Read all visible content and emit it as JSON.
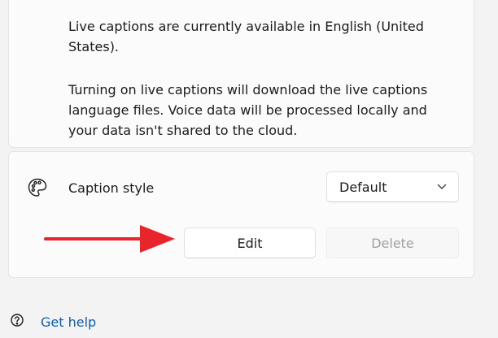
{
  "live_captions": {
    "availability_text": "Live captions are currently available in English (United States).",
    "download_notice": "Turning on live captions will download the live captions language files. Voice data will be processed locally and your data isn't shared to the cloud."
  },
  "caption_style": {
    "label": "Caption style",
    "icon": "palette-icon",
    "dropdown_value": "Default",
    "edit_label": "Edit",
    "delete_label": "Delete"
  },
  "annotation": {
    "arrow_color": "#e8252a"
  },
  "footer": {
    "help_label": "Get help",
    "link_color": "#0a5fb4"
  }
}
